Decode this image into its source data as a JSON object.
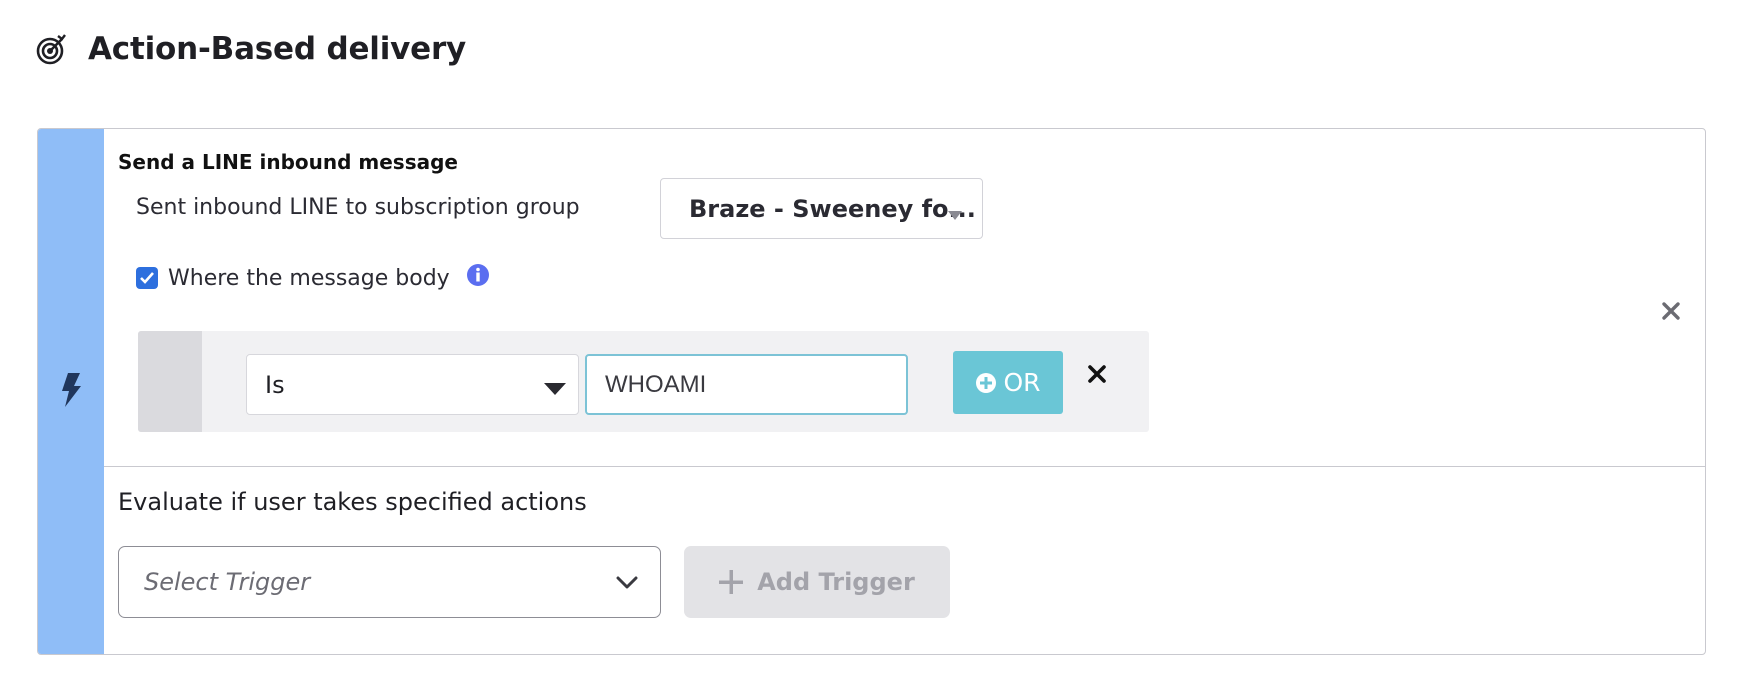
{
  "header": {
    "title": "Action-Based delivery",
    "icon": "target-icon"
  },
  "trigger_card": {
    "strip_icon": "lightning-icon",
    "strip_color": "#8fbdf7",
    "section_title": "Send a LINE inbound message",
    "subscription_label": "Sent inbound LINE to subscription group",
    "subscription_value": "Braze - Sweeney fo...",
    "checkbox_label": "Where the message body",
    "checkbox_checked": true,
    "filter": {
      "operator": "Is",
      "value": "WHOAMI",
      "or_button_label": "OR",
      "or_button_color": "#6ac6d6"
    },
    "evaluate_label": "Evaluate if user takes specified actions",
    "trigger_placeholder": "Select Trigger",
    "add_trigger_label": "Add Trigger"
  }
}
